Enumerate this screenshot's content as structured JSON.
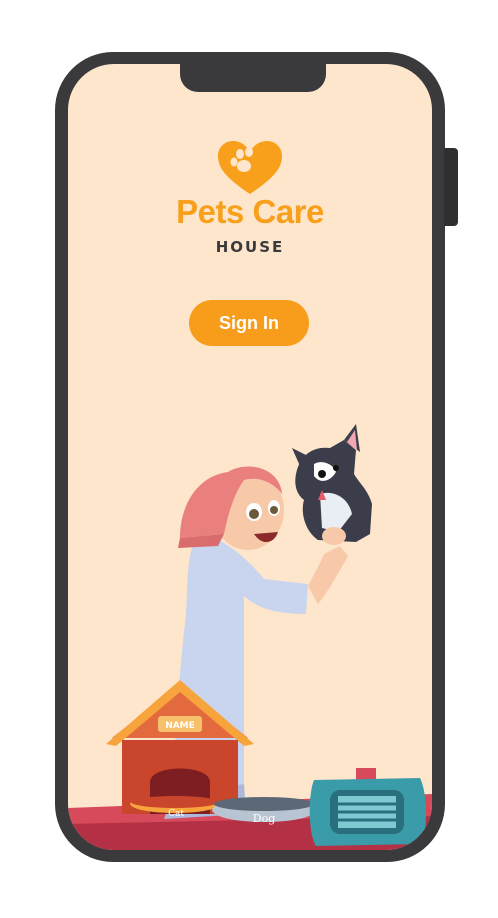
{
  "brand": {
    "name": "Pets Care",
    "subtitle": "HOUSE",
    "logo_icon": "heart-paw-icon",
    "accent_color": "#f8a01c"
  },
  "actions": {
    "signin_label": "Sign In"
  },
  "illustration": {
    "doghouse_sign": "NAME",
    "cat_bowl_label": "Cat",
    "dog_bowl_label": "Dog"
  },
  "colors": {
    "screen_bg": "#fde6cc",
    "phone_frame": "#3a3a3c",
    "button": "#f89c1c"
  }
}
